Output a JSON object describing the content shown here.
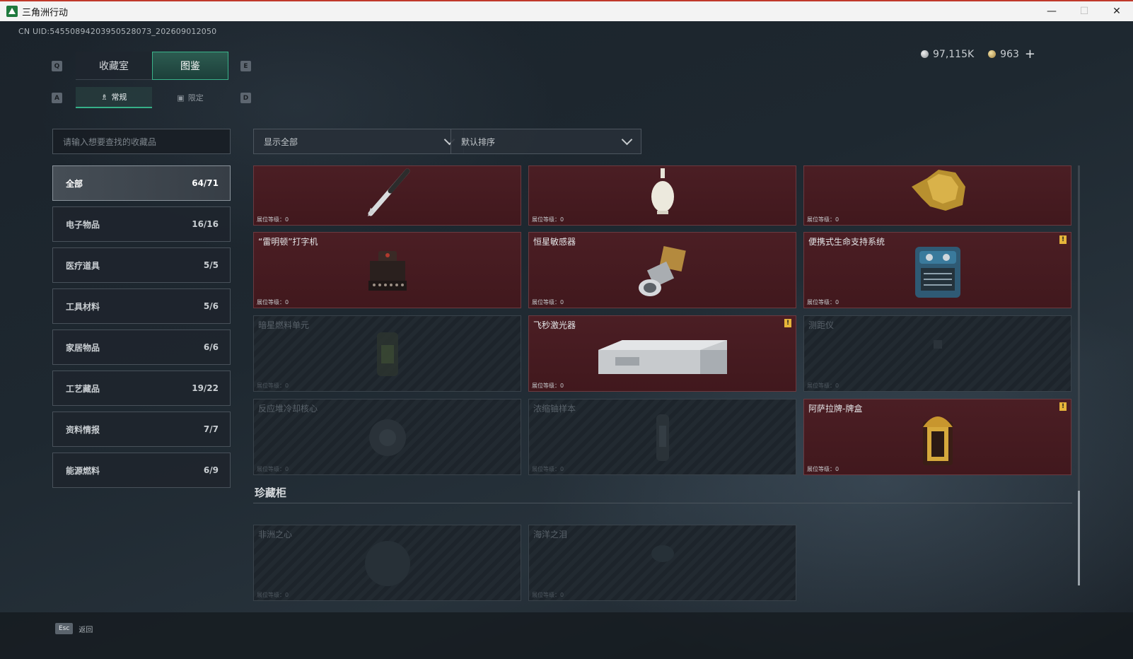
{
  "window": {
    "title": "三角洲行动",
    "minimize": "—",
    "maximize": "☐",
    "close": "✕"
  },
  "uid": "CN UID:5455089420395052807З_202609012050",
  "currency": {
    "silver": "97,115K",
    "gold": "963",
    "add": "+"
  },
  "tabs": {
    "prev_key": "Q",
    "next_key": "E",
    "items": [
      {
        "label": "收藏室"
      },
      {
        "label": "图鉴"
      }
    ]
  },
  "subtabs": {
    "prev_key": "A",
    "next_key": "D",
    "items": [
      {
        "label": "常规",
        "icon": "figure-icon"
      },
      {
        "label": "限定",
        "icon": "image-icon"
      }
    ]
  },
  "search": {
    "placeholder": "请输入想要查找的收藏品"
  },
  "filters": {
    "show": "显示全部",
    "sort": "默认排序"
  },
  "categories": [
    {
      "label": "全部",
      "count": "64/71"
    },
    {
      "label": "电子物品",
      "count": "16/16"
    },
    {
      "label": "医疗道具",
      "count": "5/5"
    },
    {
      "label": "工具材料",
      "count": "5/6"
    },
    {
      "label": "家居物品",
      "count": "6/6"
    },
    {
      "label": "工艺藏品",
      "count": "19/22"
    },
    {
      "label": "资料情报",
      "count": "7/7"
    },
    {
      "label": "能源燃料",
      "count": "6/9"
    }
  ],
  "level_label": "展位等级：0",
  "warn_badge": "!",
  "cards": [
    {
      "name": "",
      "state": "unlocked"
    },
    {
      "name": "",
      "state": "unlocked"
    },
    {
      "name": "",
      "state": "unlocked"
    },
    {
      "name": "“雷明顿”打字机",
      "state": "unlocked"
    },
    {
      "name": "恒星敏感器",
      "state": "unlocked"
    },
    {
      "name": "便携式生命支持系统",
      "state": "unlocked"
    },
    {
      "name": "暗星燃料单元",
      "state": "locked"
    },
    {
      "name": "飞秒激光器",
      "state": "unlocked"
    },
    {
      "name": "测距仪",
      "state": "locked"
    },
    {
      "name": "反应堆冷却核心",
      "state": "locked"
    },
    {
      "name": "浓缩铀样本",
      "state": "locked"
    },
    {
      "name": "阿萨拉牌-牌盒",
      "state": "unlocked"
    }
  ],
  "showcase": {
    "title": "珍藏柜",
    "cards": [
      {
        "name": "非洲之心",
        "state": "locked"
      },
      {
        "name": "海洋之泪",
        "state": "locked"
      }
    ]
  },
  "footer": {
    "esc_key": "Esc",
    "esc_label": "返回"
  }
}
